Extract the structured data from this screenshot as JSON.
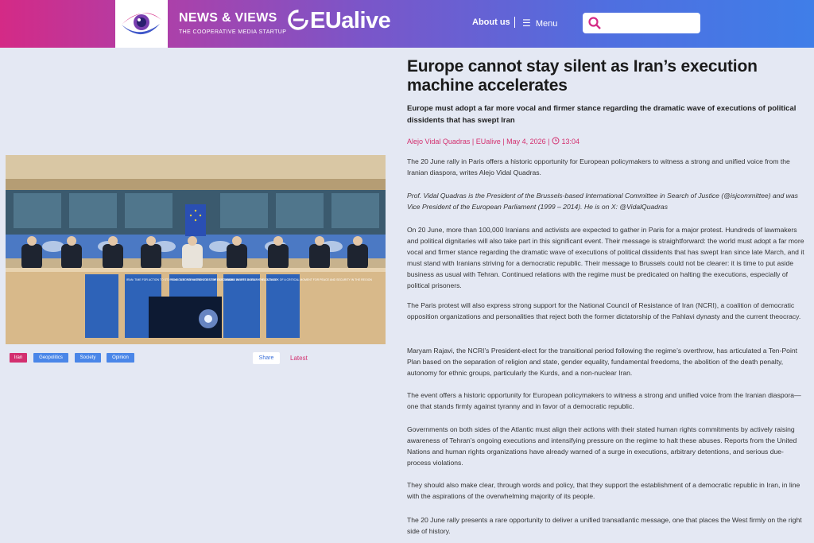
{
  "header": {
    "brand_title": "NEWS & VIEWS",
    "brand_tagline": "THE COOPERATIVE MEDIA STARTUP",
    "site_name": "EUalive",
    "nav": {
      "about": "About us",
      "menu": "Menu"
    },
    "search_placeholder": ""
  },
  "colors": {
    "accent_pink": "#d3306f",
    "tag_blue": "#4a86e8",
    "tag_red": "#d32f6f"
  },
  "photo": {
    "placards": [
      "IRAN: TIME FOR ACTION TO STOP EXECUTIONS WHERE DOES THE EU STAND?",
      "IRAN: TIME FOR ACTION TO STOP EXECUTIONS WHERE DOES THE EU STAND?",
      "HUMAN RIGHTS IN IRAN: THE OUTLOOK OF A CRITICAL MOMENT FOR PEACE AND SECURITY IN THE REGION"
    ]
  },
  "tags": [
    "Iran",
    "Geopolitics",
    "Society",
    "Opinion"
  ],
  "share_label": "Share",
  "latest_label": "Latest",
  "article": {
    "title": "Europe cannot stay silent as Iran’s execution machine accelerates",
    "subtitle": "Europe must adopt a far more vocal and firmer stance regarding the dramatic wave of executions of political dissidents that has swept Iran",
    "byline": "Alejo Vidal Quadras | EUalive | May 4, 2026 | ",
    "time": "13:04",
    "paragraphs": [
      "The 20 June rally in Paris offers a historic opportunity for European policymakers to witness a strong and unified voice from the Iranian diaspora, writes Alejo Vidal Quadras.",
      "Prof. Vidal Quadras is the President of the Brussels-based International Committee in Search of Justice (@isjcommittee) and was Vice President of the European Parliament (1999 – 2014). He is on X: @VidalQuadras",
      "On 20 June, more than 100,000 Iranians and activists are expected to gather in Paris for a major protest. Hundreds of lawmakers and political dignitaries will also take part in this significant event. Their message is straightforward: the world must adopt a far more vocal and firmer stance regarding the dramatic wave of executions of political dissidents that has swept Iran since late March, and it must stand with Iranians striving for a democratic republic. Their message to Brussels could not be clearer: it is time to put aside business as usual with Tehran. Continued relations with the regime must be predicated on halting the executions, especially of political prisoners.",
      "The Paris protest will also express strong support for the National Council of Resistance of Iran (NCRI), a coalition of democratic opposition organizations and personalities that reject both the former dictatorship of the Pahlavi dynasty and the current theocracy.",
      "Maryam Rajavi, the NCRI’s President-elect for the transitional period following the regime’s overthrow, has articulated a Ten-Point Plan based on the separation of religion and state, gender equality, fundamental freedoms, the abolition of the death penalty, autonomy for ethnic groups, particularly the Kurds, and a non-nuclear Iran.",
      "The event offers a historic opportunity for European policymakers to witness a strong and unified voice from the Iranian diaspora—one that stands firmly against tyranny and in favor of a democratic republic.",
      "Governments on both sides of the Atlantic must align their actions with their stated human rights commitments by actively raising awareness of Tehran’s ongoing executions and intensifying pressure on the regime to halt these abuses. Reports from the United Nations and human rights organizations have already warned of a surge in executions, arbitrary detentions, and serious due-process violations.",
      "They should also make clear, through words and policy, that they support the establishment of a democratic republic in Iran, in line with the aspirations of the overwhelming majority of its people.",
      "The 20 June rally presents a rare opportunity to deliver a unified transatlantic message, one that places the West firmly on the right side of history."
    ]
  }
}
